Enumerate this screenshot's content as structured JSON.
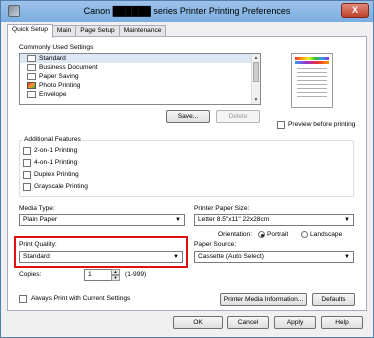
{
  "window": {
    "title": "Canon ██████ series Printer Printing Preferences",
    "close_label": "X"
  },
  "tabs": [
    "Quick Setup",
    "Main",
    "Page Setup",
    "Maintenance"
  ],
  "commonly_used": {
    "label": "Commonly Used Settings",
    "items": [
      "Standard",
      "Business Document",
      "Paper Saving",
      "Photo Printing",
      "Envelope"
    ],
    "save_label": "Save...",
    "delete_label": "Delete",
    "scroll_up": "▲",
    "scroll_down": "▼"
  },
  "preview": {
    "checkbox_label": "Preview before printing",
    "checked": false
  },
  "additional_features": {
    "label": "Additional Features",
    "items": [
      {
        "label": "2-on-1 Printing",
        "checked": false
      },
      {
        "label": "4-on-1 Printing",
        "checked": false
      },
      {
        "label": "Duplex Printing",
        "checked": false
      },
      {
        "label": "Grayscale Printing",
        "checked": false
      }
    ]
  },
  "media_type": {
    "label": "Media Type:",
    "value": "Plain Paper"
  },
  "printer_paper_size": {
    "label": "Printer Paper Size:",
    "value": "Letter 8.5\"x11\" 22x28cm"
  },
  "orientation": {
    "label": "Orientation:",
    "portrait": "Portrait",
    "landscape": "Landscape",
    "selected": "Portrait"
  },
  "print_quality": {
    "label": "Print Quality:",
    "value": "Standard"
  },
  "paper_source": {
    "label": "Paper Source:",
    "value": "Cassette (Auto Select)"
  },
  "copies": {
    "label": "Copies:",
    "value": "1",
    "range": "(1-999)"
  },
  "always_print": {
    "label": "Always Print with Current Settings",
    "checked": false
  },
  "buttons": {
    "media_info": "Printer Media Information...",
    "defaults": "Defaults",
    "ok": "OK",
    "cancel": "Cancel",
    "apply": "Apply",
    "help": "Help"
  },
  "dropdown_arrow": "▼",
  "colors": {
    "highlight": "#dd1111",
    "titlebar": "#8fb8e6"
  }
}
